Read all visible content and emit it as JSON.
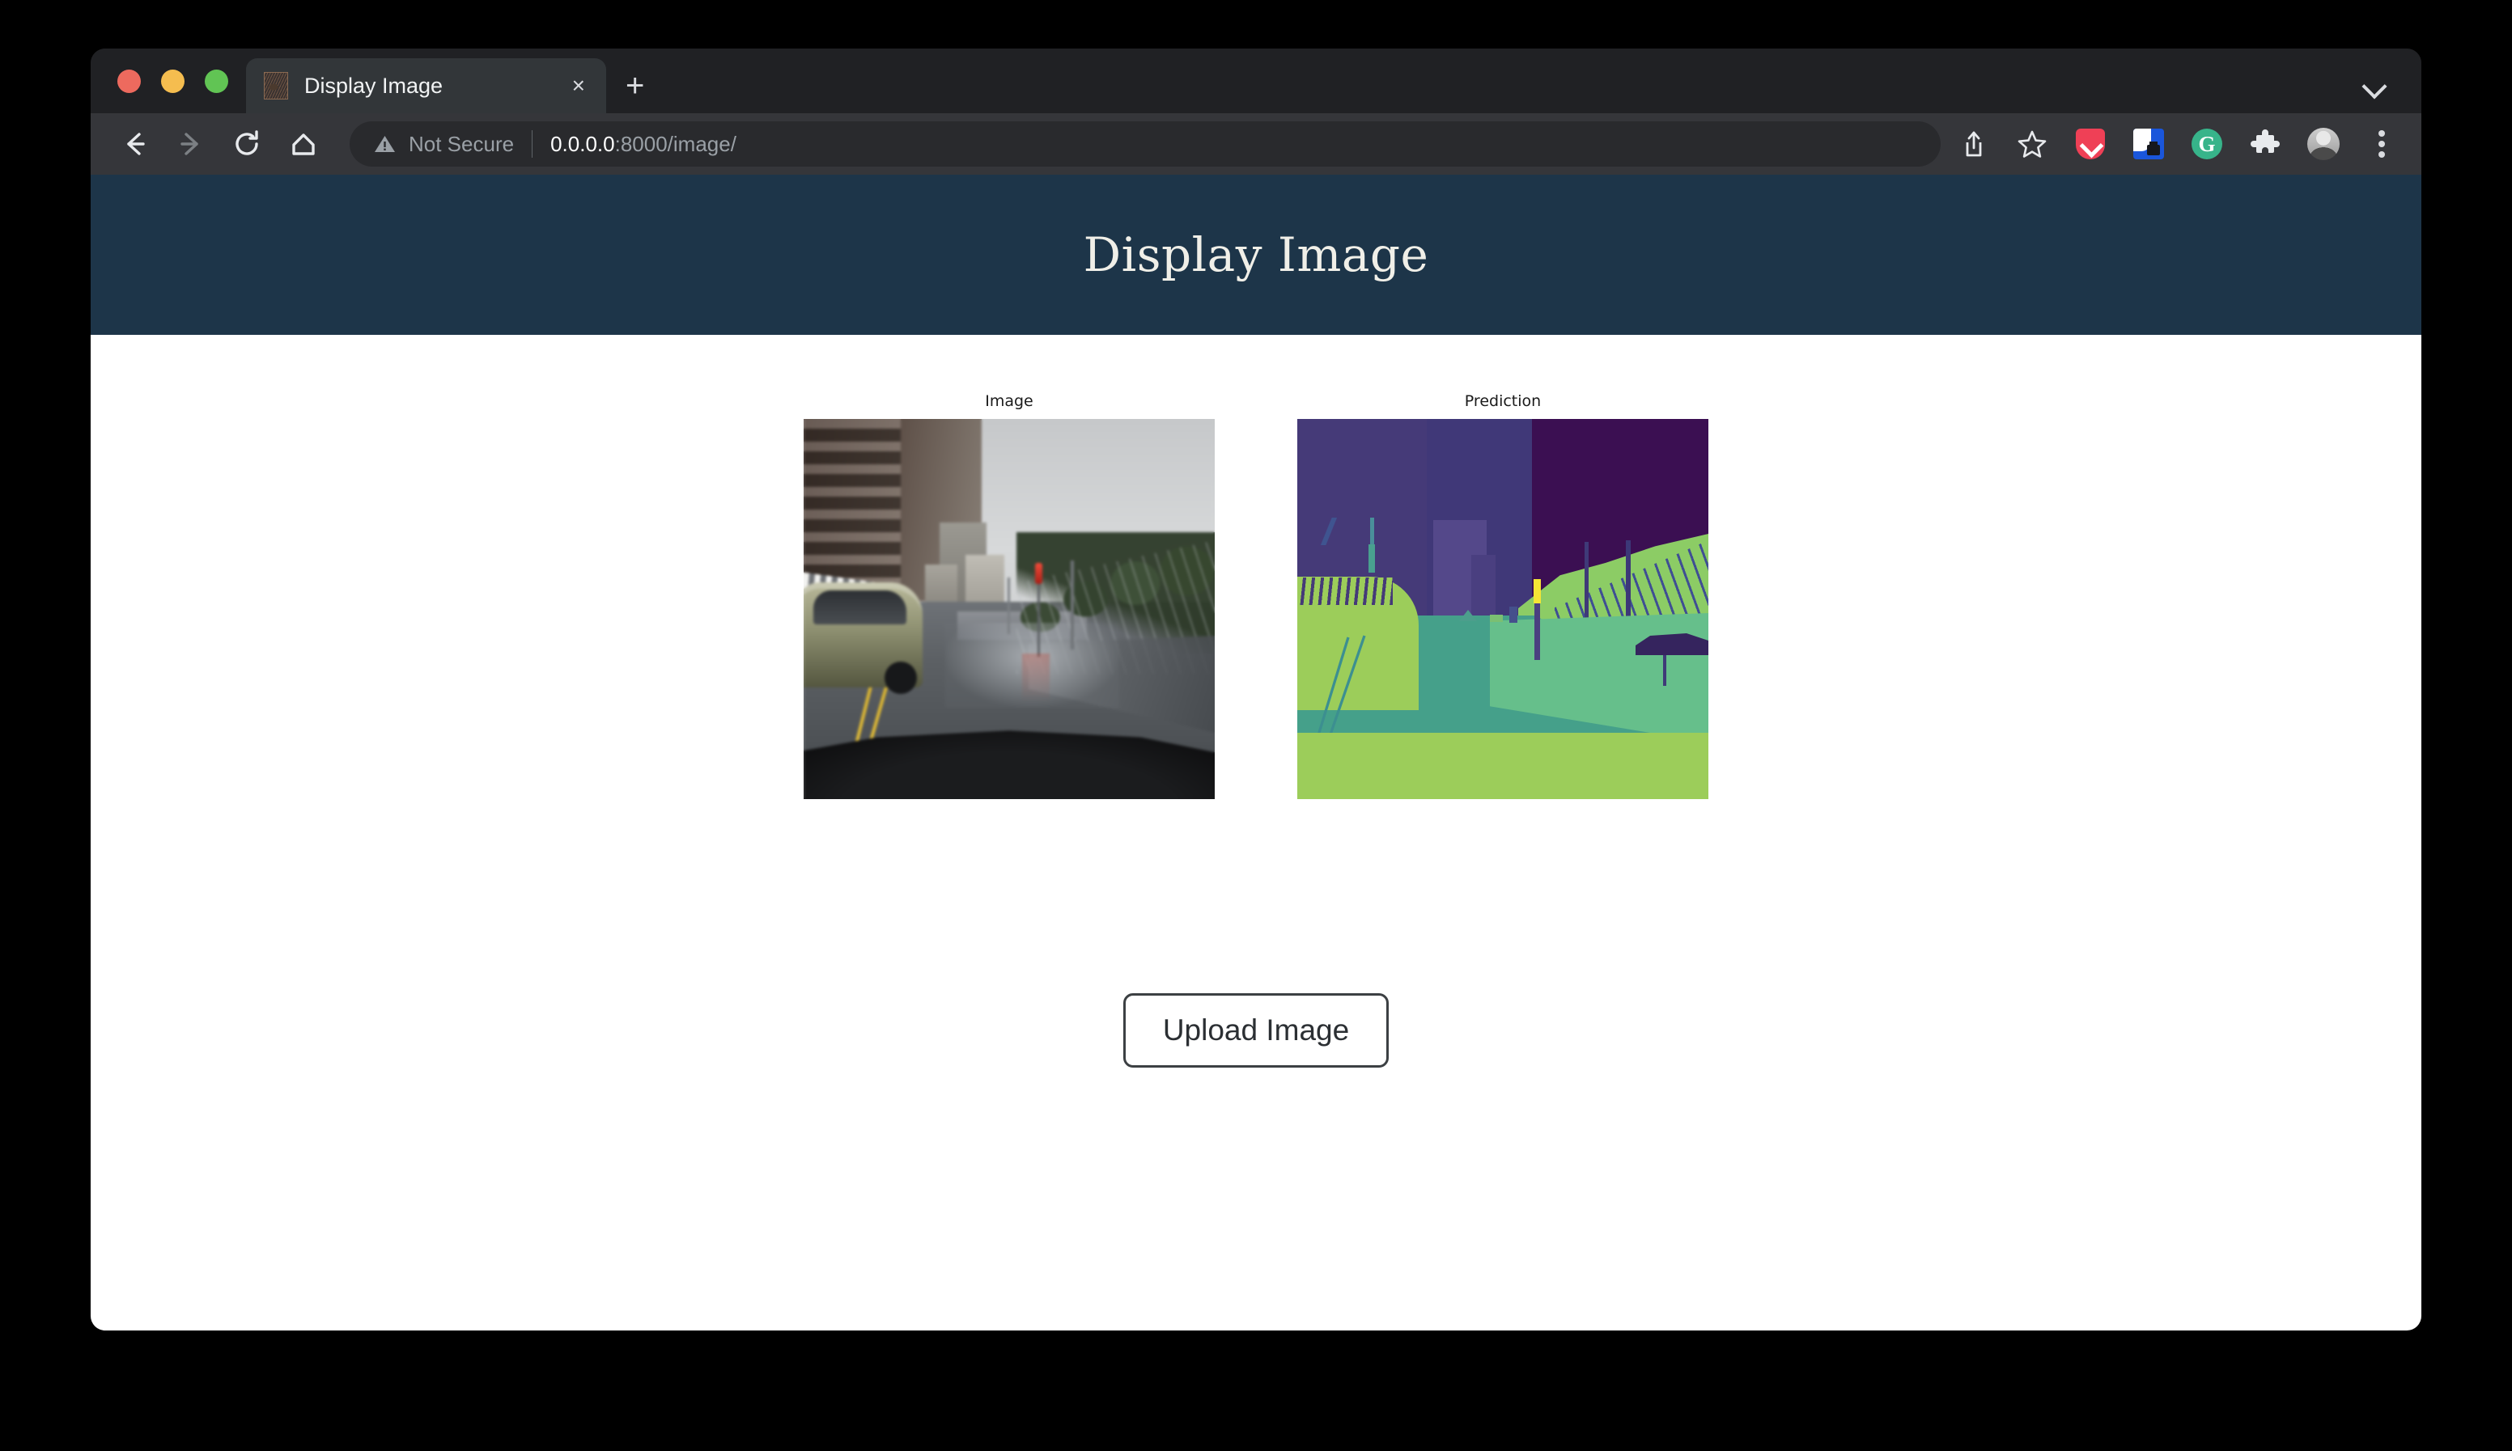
{
  "window": {
    "traffic_lights": [
      {
        "name": "close",
        "color": "#ed6a5e"
      },
      {
        "name": "minimize",
        "color": "#f5bd4f"
      },
      {
        "name": "maximize",
        "color": "#61c454"
      }
    ],
    "tab_list_chevron": "chevron-down-icon"
  },
  "tabs": [
    {
      "title": "Display Image",
      "favicon": "contour-image-favicon",
      "close": "×"
    }
  ],
  "new_tab_label": "+",
  "toolbar": {
    "back": "back-arrow-icon",
    "forward": "forward-arrow-icon",
    "reload": "reload-icon",
    "home": "home-icon",
    "security_label": "Not Secure",
    "url_host": "0.0.0.0",
    "url_rest": ":8000/image/",
    "url_full": "0.0.0.0:8000/image/",
    "icons": [
      {
        "name": "share-icon",
        "label": "Share"
      },
      {
        "name": "bookmark-star-icon",
        "label": "Bookmark"
      },
      {
        "name": "pocket-icon",
        "label": "Pocket",
        "color": "#ef4056"
      },
      {
        "name": "password-manager-icon",
        "label": "Password Manager",
        "color": "#1a56db"
      },
      {
        "name": "grammarly-icon",
        "label": "G",
        "color": "#37b48a"
      },
      {
        "name": "extensions-puzzle-icon",
        "label": "Extensions"
      },
      {
        "name": "profile-avatar",
        "label": "Profile"
      },
      {
        "name": "browser-menu-icon",
        "label": "Menu"
      }
    ]
  },
  "page": {
    "header_title": "Display Image",
    "header_bg": "#1d3549",
    "header_text_color": "#f0efe8",
    "figures": [
      {
        "caption": "Image",
        "kind": "photo"
      },
      {
        "caption": "Prediction",
        "kind": "segmentation-mask"
      }
    ],
    "upload_button_label": "Upload Image"
  }
}
